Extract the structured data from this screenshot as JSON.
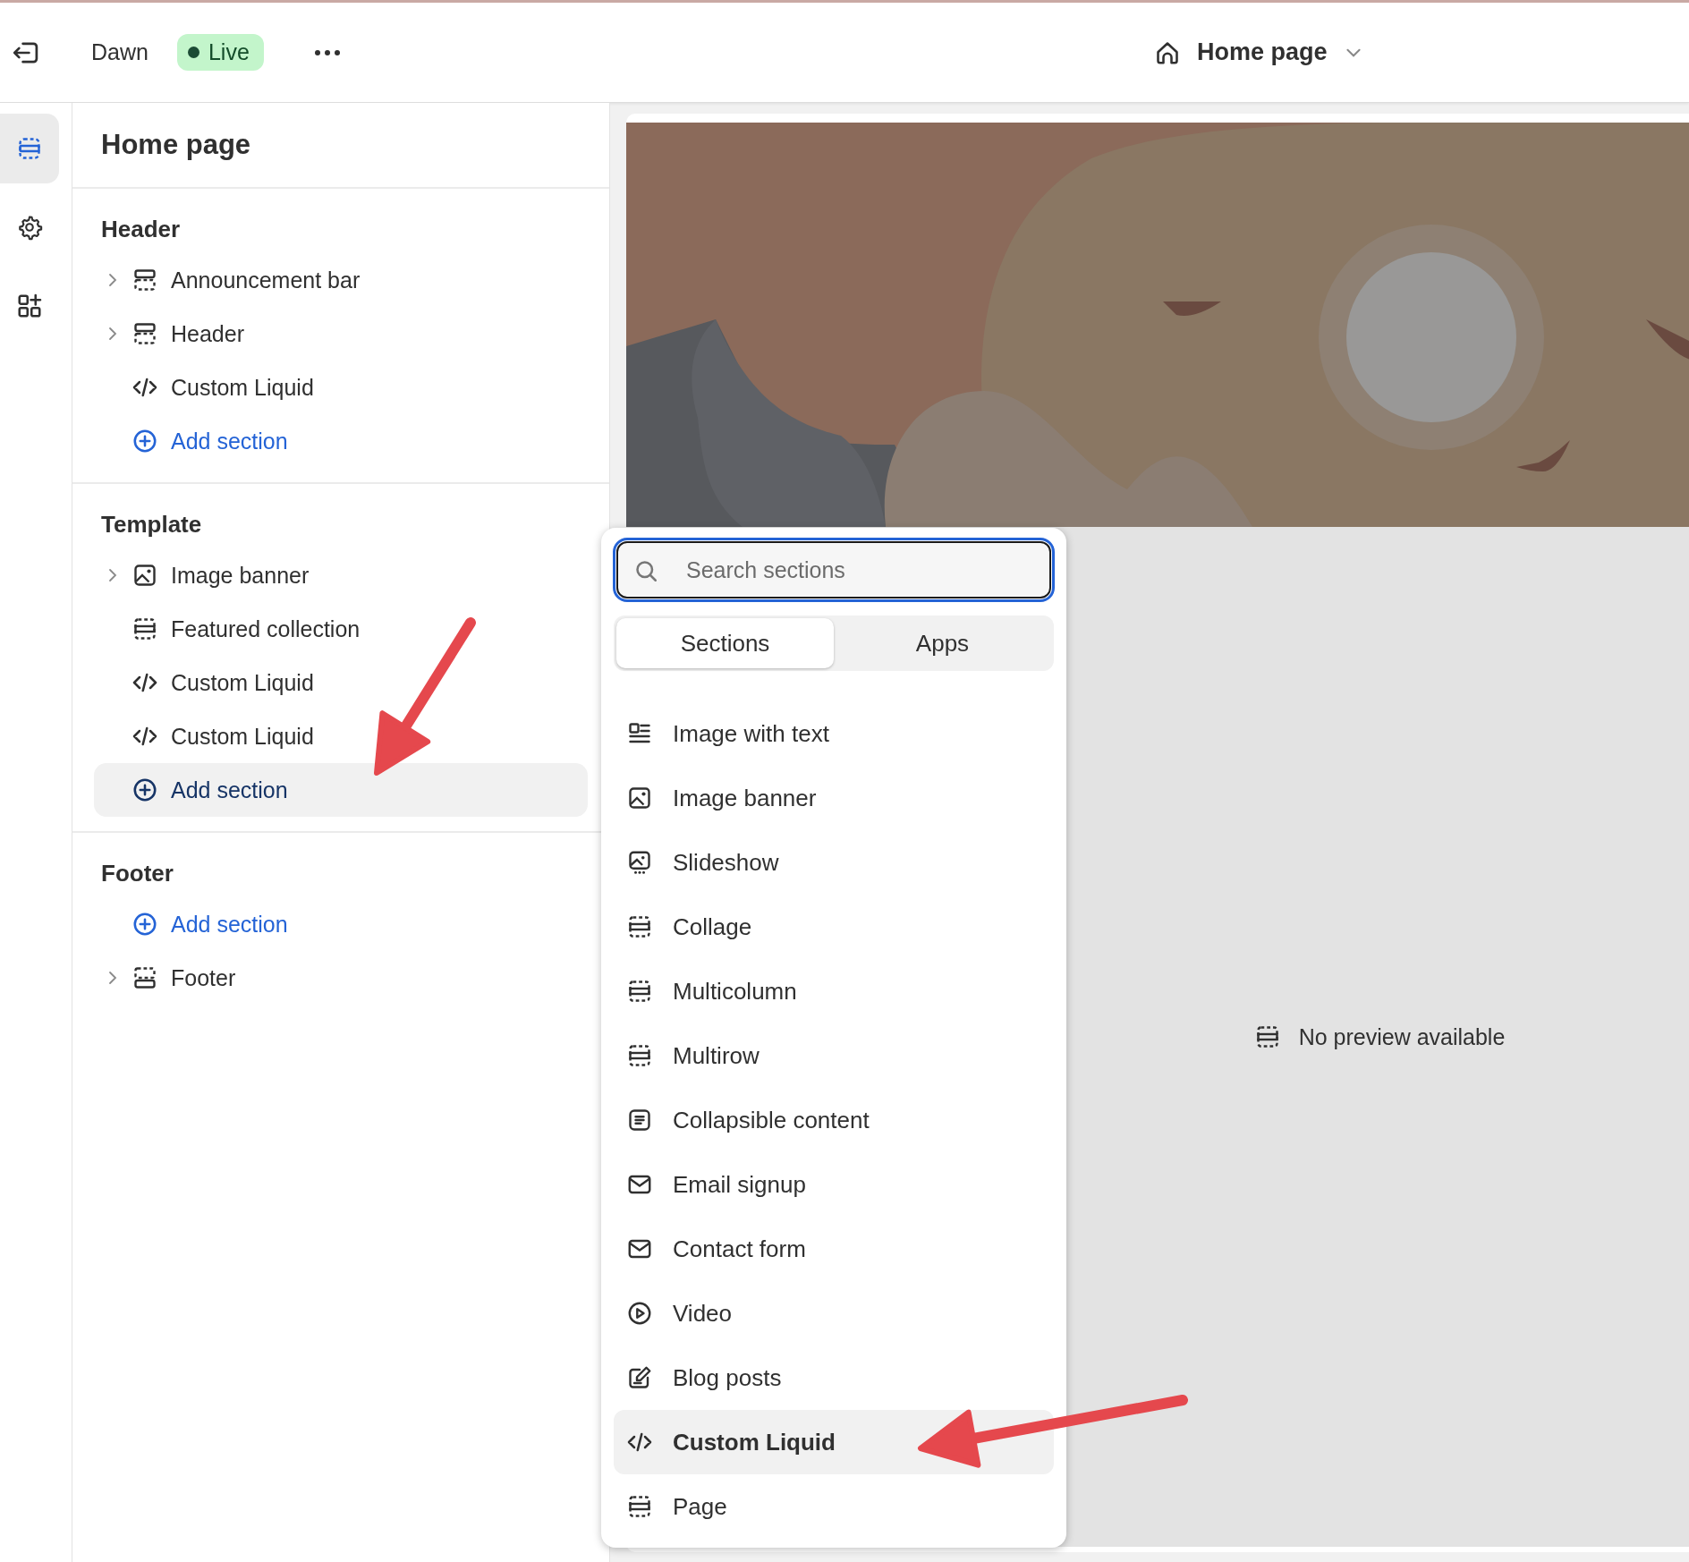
{
  "top_bar": {
    "theme_name": "Dawn",
    "status": "Live",
    "page_selector": "Home page"
  },
  "rail": [
    {
      "kind": "sections",
      "selected": true
    },
    {
      "kind": "settings",
      "selected": false
    },
    {
      "kind": "apps",
      "selected": false
    }
  ],
  "sidebar": {
    "title": "Home page",
    "groups": [
      {
        "title": "Header",
        "items": [
          {
            "label": "Announcement bar",
            "kind": "header",
            "expandable": true,
            "highlighted": false
          },
          {
            "label": "Header",
            "kind": "header",
            "expandable": true,
            "highlighted": false
          },
          {
            "label": "Custom Liquid",
            "kind": "code",
            "expandable": false,
            "highlighted": false
          },
          {
            "label": "Add section",
            "kind": "add",
            "expandable": false,
            "highlighted": false
          }
        ]
      },
      {
        "title": "Template",
        "items": [
          {
            "label": "Image banner",
            "kind": "image",
            "expandable": true,
            "highlighted": false
          },
          {
            "label": "Featured collection",
            "kind": "layout",
            "expandable": false,
            "highlighted": false
          },
          {
            "label": "Custom Liquid",
            "kind": "code",
            "expandable": false,
            "highlighted": false
          },
          {
            "label": "Custom Liquid",
            "kind": "code",
            "expandable": false,
            "highlighted": false
          },
          {
            "label": "Add section",
            "kind": "add",
            "expandable": false,
            "highlighted": true
          }
        ]
      },
      {
        "title": "Footer",
        "items": [
          {
            "label": "Add section",
            "kind": "add",
            "expandable": false,
            "highlighted": false
          },
          {
            "label": "Footer",
            "kind": "footer",
            "expandable": true,
            "highlighted": false
          }
        ]
      }
    ]
  },
  "picker": {
    "search": {
      "placeholder": "Search sections"
    },
    "tabs": [
      {
        "label": "Sections",
        "selected": true
      },
      {
        "label": "Apps",
        "selected": false
      }
    ],
    "sections": [
      {
        "label": "Image with text",
        "kind": "image-text",
        "highlighted": false
      },
      {
        "label": "Image banner",
        "kind": "image",
        "highlighted": false
      },
      {
        "label": "Slideshow",
        "kind": "slideshow",
        "highlighted": false
      },
      {
        "label": "Collage",
        "kind": "layout",
        "highlighted": false
      },
      {
        "label": "Multicolumn",
        "kind": "layout",
        "highlighted": false
      },
      {
        "label": "Multirow",
        "kind": "layout",
        "highlighted": false
      },
      {
        "label": "Collapsible content",
        "kind": "list",
        "highlighted": false
      },
      {
        "label": "Email signup",
        "kind": "envelope",
        "highlighted": false
      },
      {
        "label": "Contact form",
        "kind": "envelope",
        "highlighted": false
      },
      {
        "label": "Video",
        "kind": "play",
        "highlighted": false
      },
      {
        "label": "Blog posts",
        "kind": "edit",
        "highlighted": false
      },
      {
        "label": "Custom Liquid",
        "kind": "code",
        "highlighted": true
      },
      {
        "label": "Page",
        "kind": "layout",
        "highlighted": false
      }
    ]
  },
  "preview": {
    "message": "No preview available"
  }
}
